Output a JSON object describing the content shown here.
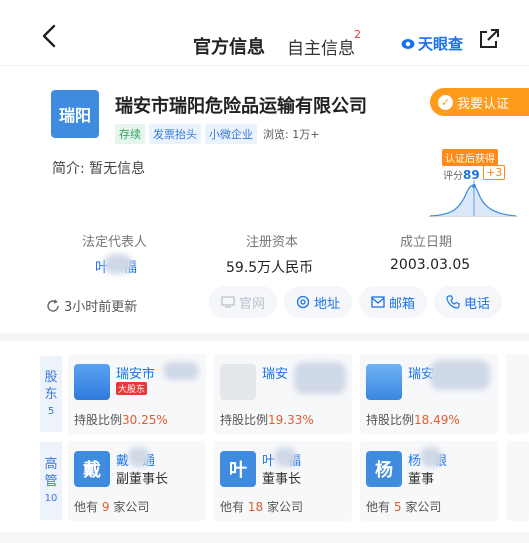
{
  "nav": {
    "tab_official": "官方信息",
    "tab_self": "自主信息",
    "tab_badge": "2",
    "brand": "天眼查"
  },
  "company": {
    "logo_text": "瑞阳",
    "name": "瑞安市瑞阳危险品运输有限公司",
    "verify_label": "我要认证",
    "tags": [
      "存续",
      "发票抬头",
      "小微企业"
    ],
    "views": "浏览: 1万+",
    "intro": "简介: 暂无信息"
  },
  "rating": {
    "tag": "认证后获得",
    "score_label": "评分",
    "score": "89",
    "delta": "+3"
  },
  "key_info": {
    "legal_label": "法定代表人",
    "legal_value": "叶　福",
    "capital_label": "注册资本",
    "capital_value": "59.5万人民币",
    "date_label": "成立日期",
    "date_value": "2003.03.05"
  },
  "updated": "3小时前更新",
  "links": {
    "website": "官网",
    "address": "地址",
    "email": "邮箱",
    "phone": "电话"
  },
  "shareholders": {
    "label": [
      "股",
      "东"
    ],
    "count": "5",
    "items": [
      {
        "name": "瑞安市",
        "badge": "大股东",
        "ratio_label": "持股比例",
        "ratio": "30.25%"
      },
      {
        "name": "瑞安",
        "sub": "",
        "ratio_label": "持股比例",
        "ratio": "19.33%"
      },
      {
        "name": "瑞安",
        "ratio_label": "持股比例",
        "ratio": "18.49%"
      }
    ]
  },
  "executives": {
    "label": [
      "高",
      "管"
    ],
    "count": "10",
    "items": [
      {
        "avatar": "戴",
        "name": "戴　通",
        "role": "副董事长",
        "foot_pre": "他有",
        "foot_num": "9",
        "foot_post": "家公司"
      },
      {
        "avatar": "叶",
        "name": "叶　福",
        "role": "董事长",
        "foot_pre": "他有",
        "foot_num": "18",
        "foot_post": "家公司"
      },
      {
        "avatar": "杨",
        "name": "杨　根",
        "role": "董事",
        "foot_pre": "他有",
        "foot_num": "5",
        "foot_post": "家公司"
      }
    ]
  },
  "colors": {
    "brand_blue": "#1a73e8",
    "verify_orange": "#ff9a1a",
    "red": "#e53935"
  }
}
